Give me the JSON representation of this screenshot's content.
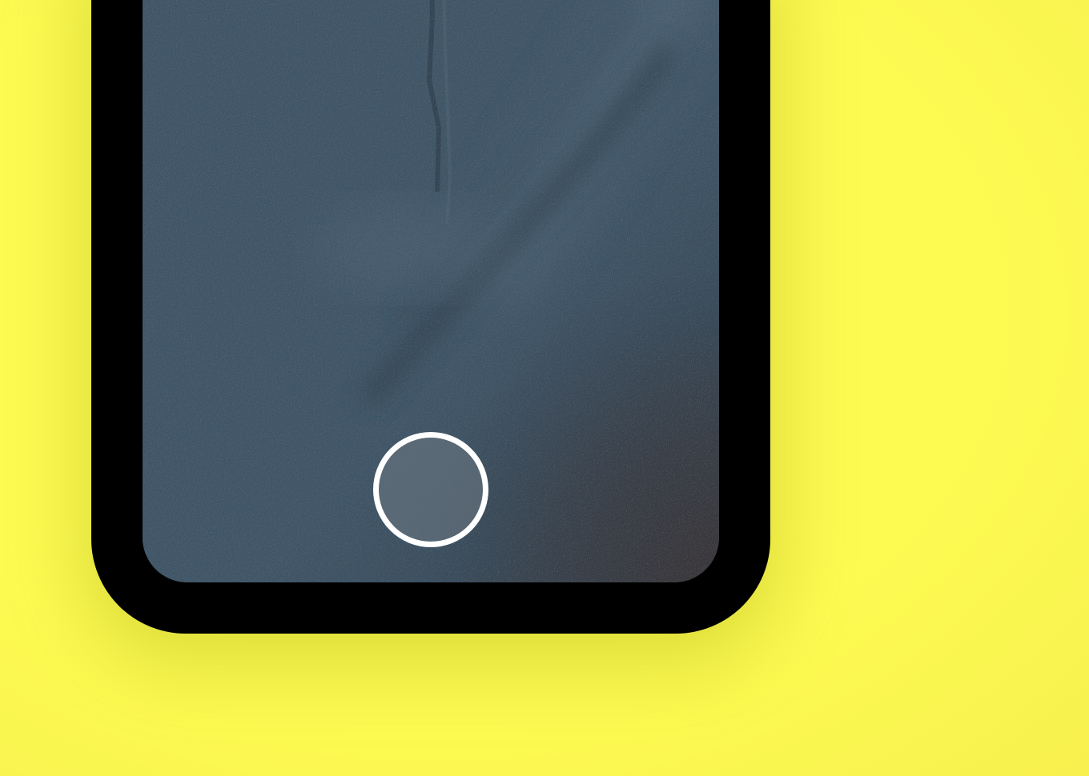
{
  "app": {
    "background_color": "#FDFB52",
    "background_edge_color": "#F7F04E"
  },
  "phone": {
    "frame_color": "#000000",
    "viewfinder": {
      "base_color": "#3F5567",
      "highlight_color": "#556B7B",
      "shadow_color": "#2F4251",
      "corner_dark_color": "#3A3335"
    },
    "shutter_button": {
      "icon": "shutter-ring-icon",
      "ring_color": "#FFFFFF",
      "fill_color": "#6B7680"
    }
  }
}
